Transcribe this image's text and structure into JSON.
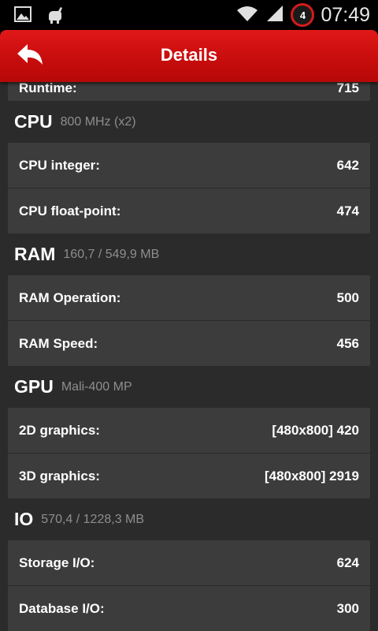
{
  "status_bar": {
    "time": "07:49",
    "notification_count": "4",
    "icons": [
      "gallery-icon",
      "android-icon",
      "wifi-icon",
      "signal-icon",
      "antutu-notification-icon"
    ]
  },
  "header": {
    "title": "Details",
    "back_icon": "back-arrow-icon",
    "color": "#cc1111"
  },
  "runtime": {
    "label": "Runtime:",
    "value": "715"
  },
  "sections": [
    {
      "name": "CPU",
      "info": "800 MHz (x2)",
      "rows": [
        {
          "label": "CPU integer:",
          "value": "642"
        },
        {
          "label": "CPU float-point:",
          "value": "474"
        }
      ]
    },
    {
      "name": "RAM",
      "info": "160,7 / 549,9 MB",
      "rows": [
        {
          "label": "RAM Operation:",
          "value": "500"
        },
        {
          "label": "RAM Speed:",
          "value": "456"
        }
      ]
    },
    {
      "name": "GPU",
      "info": "Mali-400 MP",
      "rows": [
        {
          "label": "2D graphics:",
          "value": "[480x800] 420"
        },
        {
          "label": "3D graphics:",
          "value": "[480x800] 2919"
        }
      ]
    },
    {
      "name": "IO",
      "info": "570,4 / 1228,3 MB",
      "rows": [
        {
          "label": "Storage I/O:",
          "value": "624"
        },
        {
          "label": "Database I/O:",
          "value": "300"
        }
      ]
    }
  ]
}
